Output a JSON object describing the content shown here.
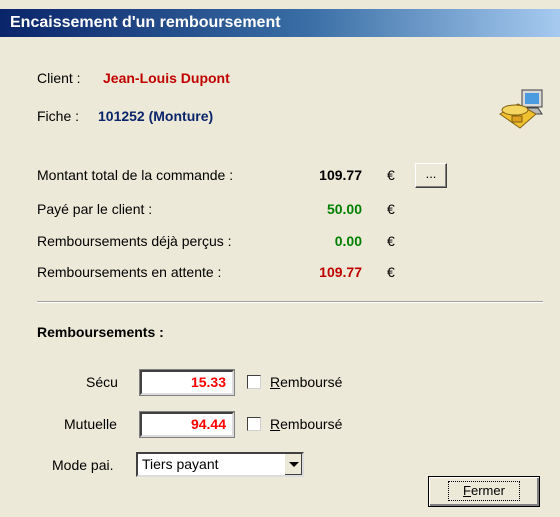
{
  "window": {
    "title": "Encaissement d'un remboursement"
  },
  "client": {
    "label": "Client :",
    "value": "Jean-Louis Dupont"
  },
  "fiche": {
    "label": "Fiche :",
    "value": "101252 (Monture)"
  },
  "amounts": [
    {
      "label": "Montant total de la commande :",
      "value": "109.77",
      "currency": "€",
      "color": "#000000"
    },
    {
      "label": "Payé par le client :",
      "value": "50.00",
      "currency": "€",
      "color": "#008000"
    },
    {
      "label": "Remboursements déjà perçus :",
      "value": "0.00",
      "currency": "€",
      "color": "#008000"
    },
    {
      "label": "Remboursements en attente :",
      "value": "109.77",
      "currency": "€",
      "color": "#c00000"
    }
  ],
  "details_button": {
    "label": "..."
  },
  "refunds": {
    "heading": "Remboursements :",
    "secu": {
      "label": "Sécu",
      "value": "15.33",
      "checkbox_first": "R",
      "checkbox_rest": "emboursé",
      "checked": false
    },
    "mutuelle": {
      "label": "Mutuelle",
      "value": "94.44",
      "checkbox_first": "R",
      "checkbox_rest": "emboursé",
      "checked": false
    },
    "mode": {
      "label": "Mode pai.",
      "selected": "Tiers payant"
    }
  },
  "close_button": {
    "first": "F",
    "rest": "ermer"
  },
  "icon": {
    "name": "phone-computer-icon"
  }
}
